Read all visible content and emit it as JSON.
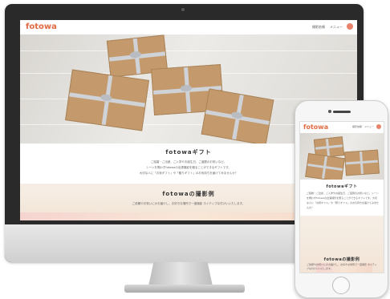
{
  "desktop": {
    "logo": "fotowa",
    "nav": [
      "撮影依頼",
      "メニュー"
    ],
    "hero_section_title": "fotowaギフト",
    "hero_text": [
      "ご結婚・ご出産、ご入学やお誕生日、ご還暦のお祝いなど。",
      "シーンを問わずfotowaの出張撮影を贈ることができるギフトです。",
      "大切な人に「お祝ギフト」や「贈りギフト」のお気持ちを届けてみませんか？"
    ],
    "examples_title": "fotowaの撮影例",
    "examples_text": "ご依頼やお祝いにかお届けし、お好きな場所で一度撮影 ネイティブな付けいいたします。"
  },
  "phone": {
    "logo": "fotowa",
    "nav": [
      "撮影依頼",
      "メニュー"
    ],
    "hero_section_title": "fotowaギフト",
    "hero_text": "ご結婚・ご出産、ご入学やお誕生日、ご還暦のお祝いなど。シーンを問わずfotowaの出張撮影を贈ることができるギフトです。大切な人に「お祝ギフト」や「贈りギフト」のお気持ちを届けてみませんか？",
    "examples_title": "fotowaの撮影例",
    "examples_text": "ご依頼やお祝いにかお届けし、お好きな場所で一度撮影 ネイティブな付けいいたします。"
  },
  "colors": {
    "brand": "#e06a42",
    "bezel": "#2a2a2a",
    "gift_paper": "#c49a6c",
    "ribbon": "#cfd2d6"
  }
}
